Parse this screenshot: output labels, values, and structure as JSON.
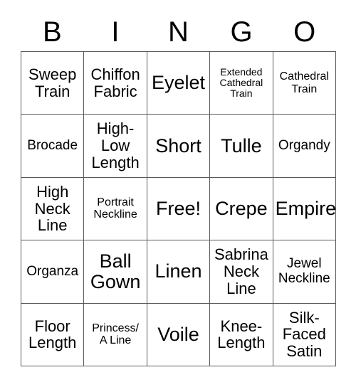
{
  "header": {
    "letters": [
      "B",
      "I",
      "N",
      "G",
      "O"
    ]
  },
  "grid": {
    "rows": 5,
    "columns": 5,
    "border_color": "#595959",
    "text_color": "#000000",
    "background_color": "#ffffff",
    "cells": [
      {
        "text": "Sweep\nTrain",
        "size": "lg"
      },
      {
        "text": "Chiffon\nFabric",
        "size": "lg"
      },
      {
        "text": "Eyelet",
        "size": "xl"
      },
      {
        "text": "Extended\nCathedral\nTrain",
        "size": "xs"
      },
      {
        "text": "Cathedral\nTrain",
        "size": "sm"
      },
      {
        "text": "Brocade",
        "size": "md"
      },
      {
        "text": "High-\nLow\nLength",
        "size": "lg"
      },
      {
        "text": "Short",
        "size": "xl"
      },
      {
        "text": "Tulle",
        "size": "xl"
      },
      {
        "text": "Organdy",
        "size": "md"
      },
      {
        "text": "High\nNeck\nLine",
        "size": "lg"
      },
      {
        "text": "Portrait\nNeckline",
        "size": "sm"
      },
      {
        "text": "Free!",
        "size": "xl"
      },
      {
        "text": "Crepe",
        "size": "xl"
      },
      {
        "text": "Empire",
        "size": "xl"
      },
      {
        "text": "Organza",
        "size": "md"
      },
      {
        "text": "Ball\nGown",
        "size": "xl"
      },
      {
        "text": "Linen",
        "size": "xl"
      },
      {
        "text": "Sabrina\nNeck\nLine",
        "size": "lg"
      },
      {
        "text": "Jewel\nNeckline",
        "size": "md"
      },
      {
        "text": "Floor\nLength",
        "size": "lg"
      },
      {
        "text": "Princess/\nA Line",
        "size": "sm"
      },
      {
        "text": "Voile",
        "size": "xl"
      },
      {
        "text": "Knee-\nLength",
        "size": "lg"
      },
      {
        "text": "Silk-\nFaced\nSatin",
        "size": "lg"
      }
    ]
  }
}
